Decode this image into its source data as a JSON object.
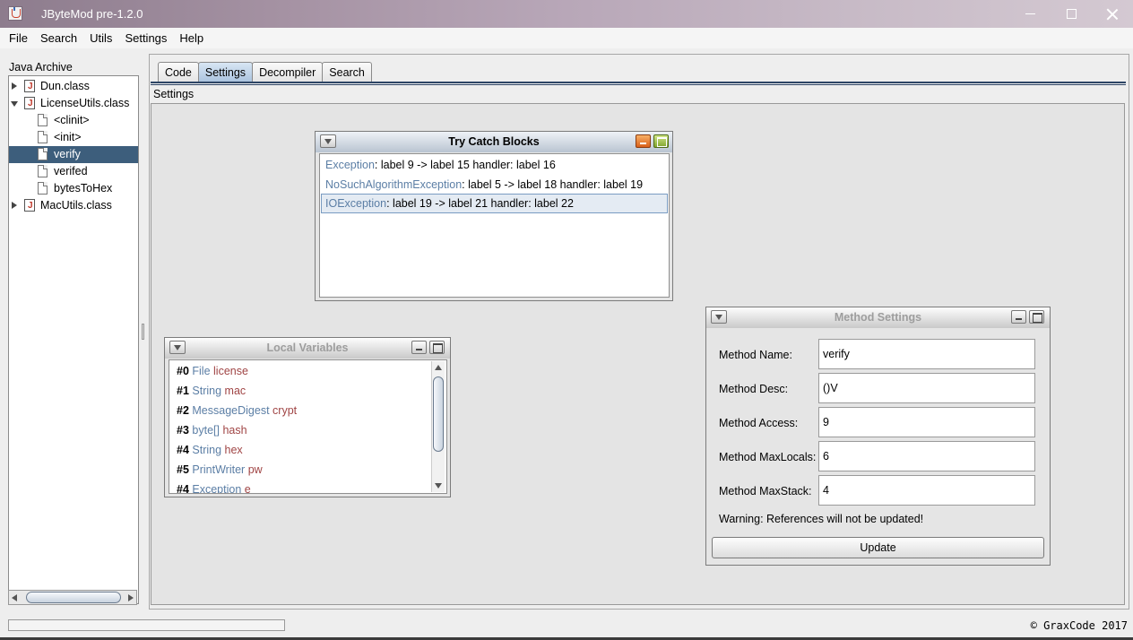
{
  "window": {
    "title": "JByteMod pre-1.2.0"
  },
  "menu": [
    "File",
    "Search",
    "Utils",
    "Settings",
    "Help"
  ],
  "sidebar": {
    "title": "Java Archive",
    "tree": [
      {
        "label": "Dun.class",
        "kind": "class",
        "state": "collapsed"
      },
      {
        "label": "LicenseUtils.class",
        "kind": "class",
        "state": "expanded"
      },
      {
        "label": "<clinit>",
        "kind": "method"
      },
      {
        "label": "<init>",
        "kind": "method"
      },
      {
        "label": "verify",
        "kind": "method",
        "selected": true
      },
      {
        "label": "verifed",
        "kind": "method"
      },
      {
        "label": "bytesToHex",
        "kind": "method"
      },
      {
        "label": "MacUtils.class",
        "kind": "class",
        "state": "collapsed"
      }
    ]
  },
  "tabs": [
    {
      "label": "Code"
    },
    {
      "label": "Settings",
      "active": true
    },
    {
      "label": "Decompiler"
    },
    {
      "label": "Search"
    }
  ],
  "section_label": "Settings",
  "try_catch": {
    "title": "Try Catch Blocks",
    "rows": [
      {
        "type": "Exception",
        "rest": ": label 9 -> label 15 handler: label 16"
      },
      {
        "type": "NoSuchAlgorithmException",
        "rest": ": label 5 -> label 18 handler: label 19"
      },
      {
        "type": "IOException",
        "rest": ": label 19 -> label 21 handler: label 22",
        "selected": true
      }
    ]
  },
  "local_vars": {
    "title": "Local Variables",
    "rows": [
      {
        "idx": "#0",
        "type": "File",
        "name": "license"
      },
      {
        "idx": "#1",
        "type": "String",
        "name": "mac"
      },
      {
        "idx": "#2",
        "type": "MessageDigest",
        "name": "crypt"
      },
      {
        "idx": "#3",
        "type": "byte[]",
        "name": "hash"
      },
      {
        "idx": "#4",
        "type": "String",
        "name": "hex"
      },
      {
        "idx": "#5",
        "type": "PrintWriter",
        "name": "pw"
      },
      {
        "idx": "#4",
        "type": "Exception",
        "name": "e"
      }
    ]
  },
  "method_settings": {
    "title": "Method Settings",
    "fields": [
      {
        "label": "Method Name:",
        "value": "verify"
      },
      {
        "label": "Method Desc:",
        "value": "()V"
      },
      {
        "label": "Method Access:",
        "value": "9"
      },
      {
        "label": "Method MaxLocals:",
        "value": "6"
      },
      {
        "label": "Method MaxStack:",
        "value": "4"
      }
    ],
    "warning": "Warning: References will not be updated!",
    "update_label": "Update"
  },
  "status": {
    "copyright": "© GraxCode 2017"
  }
}
